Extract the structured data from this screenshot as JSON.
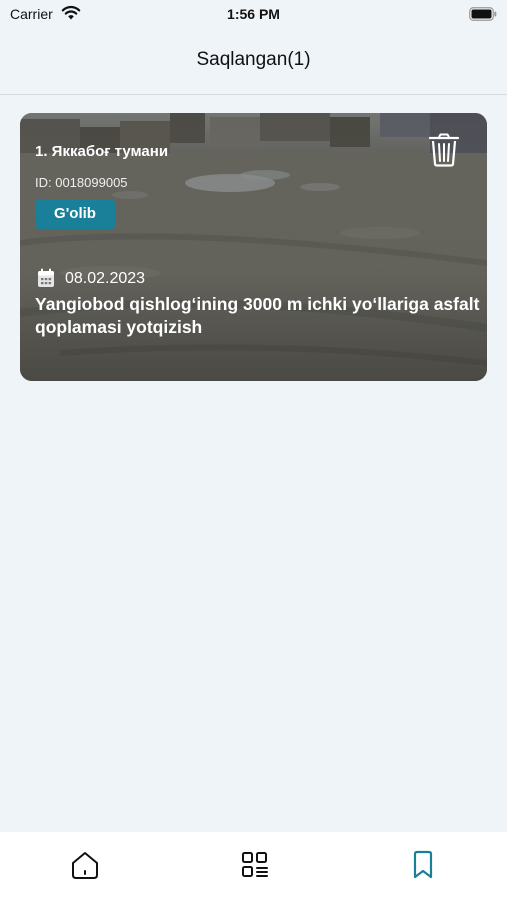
{
  "status_bar": {
    "carrier": "Carrier",
    "time": "1:56 PM",
    "wifi_icon": "wifi-icon",
    "battery_icon": "battery-icon"
  },
  "header": {
    "title": "Saqlangan(1)"
  },
  "saved_items": [
    {
      "district": "1. Яккабоғ тумани",
      "id_text": "ID: 0018099005",
      "status": "G'olib",
      "date": "08.02.2023",
      "title": "Yangiobod qishlog‘ining 3000 m ichki yo‘llariga asfalt qoplamasi yotqizish",
      "delete_icon": "trash-icon",
      "date_icon": "calendar-icon"
    }
  ],
  "bottom_nav": [
    {
      "icon": "home-icon",
      "active": false
    },
    {
      "icon": "grid-icon",
      "active": false
    },
    {
      "icon": "bookmark-icon",
      "active": true
    }
  ],
  "colors": {
    "background": "#eff4f8",
    "badge": "#1a7f98",
    "nav_active": "#1a7f98",
    "nav_inactive": "#111111"
  }
}
